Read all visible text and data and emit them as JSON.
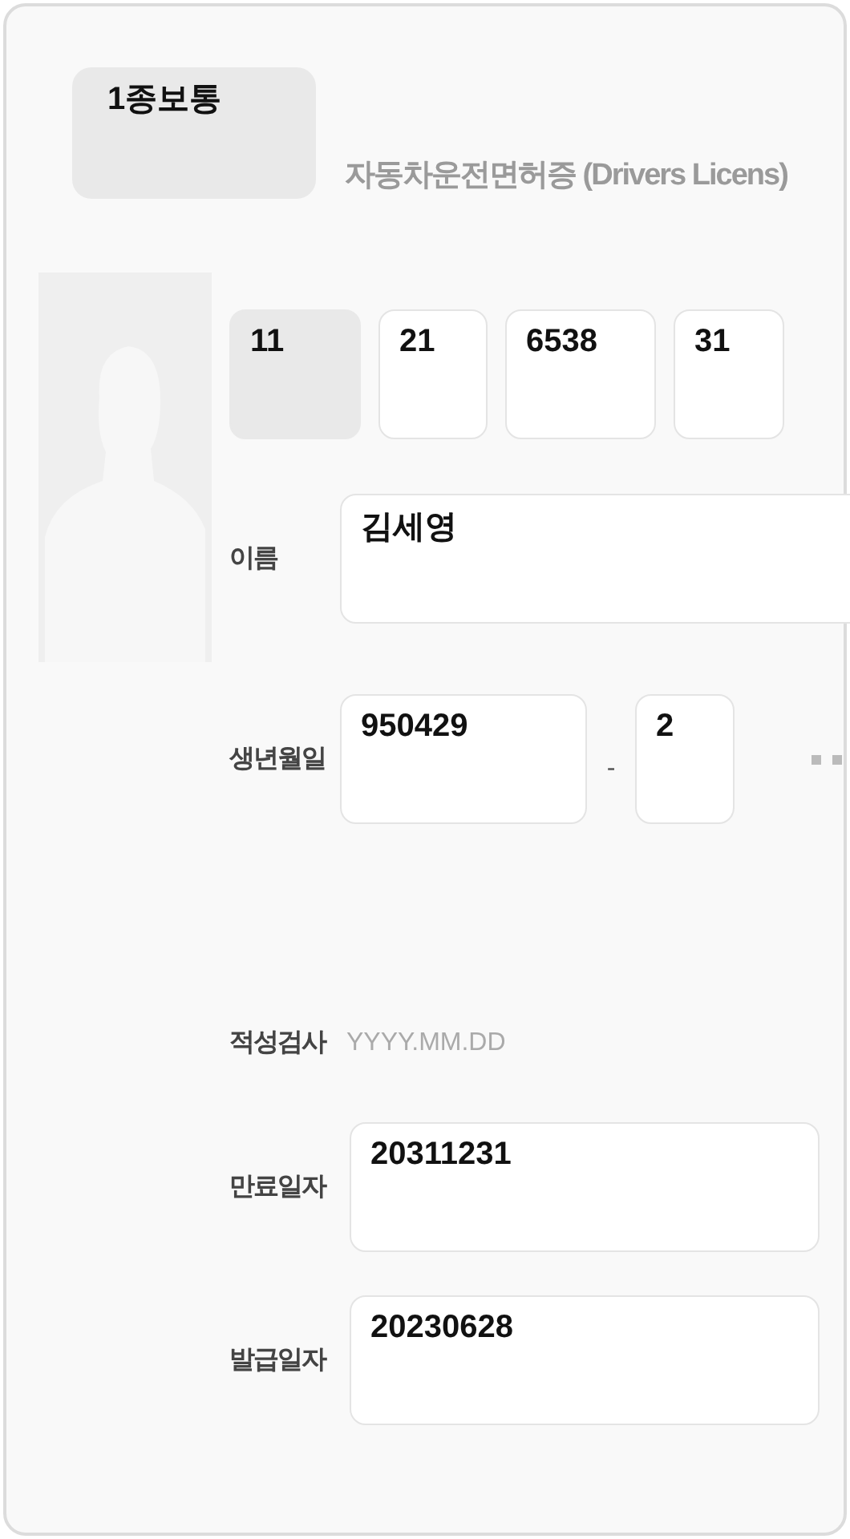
{
  "license_type": "1종보통",
  "title": "자동차운전면허증 (Drivers Licens)",
  "license_number": [
    {
      "value": "11",
      "disabled": true
    },
    {
      "value": "21",
      "disabled": false
    },
    {
      "value": "6538",
      "disabled": false
    },
    {
      "value": "31",
      "disabled": false
    }
  ],
  "name": {
    "label": "이름",
    "value": "김세영"
  },
  "birth": {
    "label": "생년월일",
    "front": "950429",
    "separator": "-",
    "back": "2"
  },
  "aptitude": {
    "label": "적성검사",
    "placeholder": "YYYY.MM.DD"
  },
  "expiry": {
    "label": "만료일자",
    "value": "20311231"
  },
  "issue": {
    "label": "발급일자",
    "value": "20230628"
  }
}
